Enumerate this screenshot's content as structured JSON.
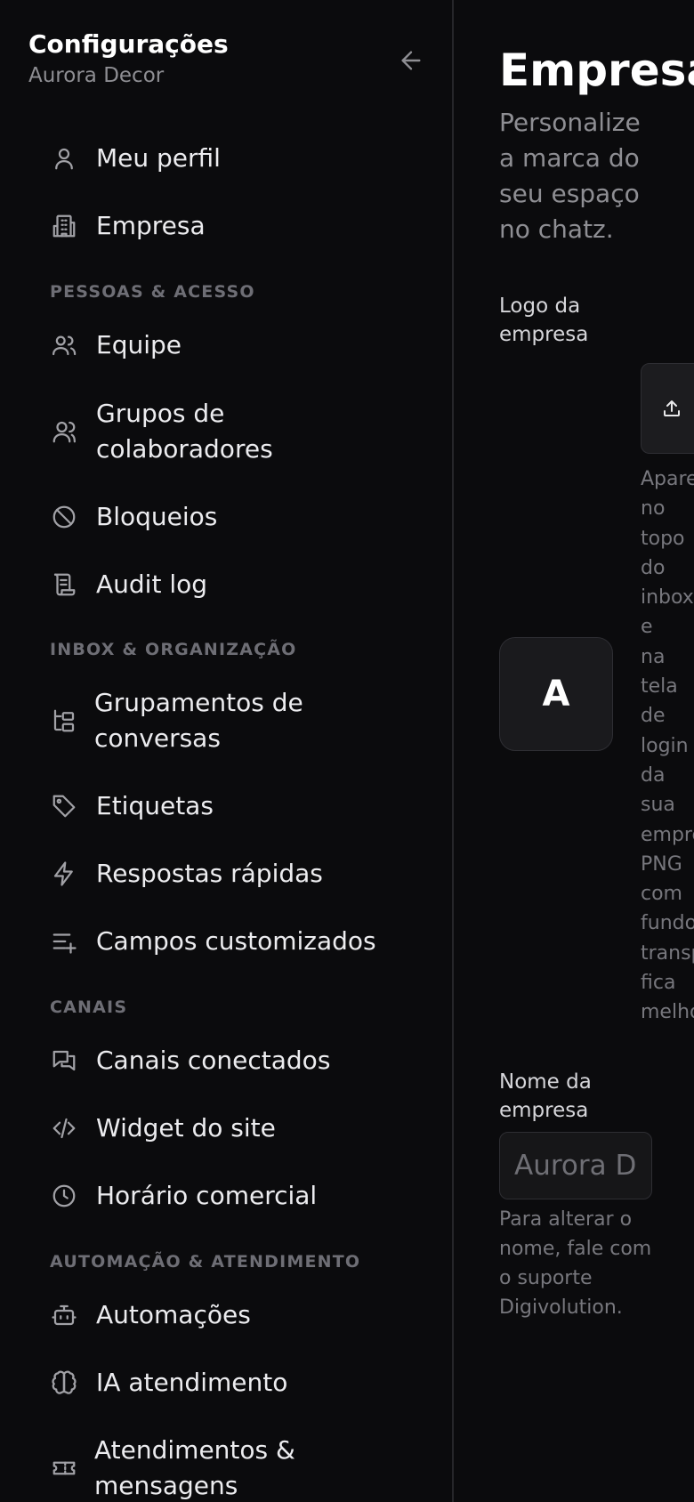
{
  "sidebar": {
    "title": "Configurações",
    "subtitle": "Aurora Decor",
    "back_icon": "arrow-left-icon",
    "items": [
      {
        "label": "Meu perfil",
        "icon": "user-icon"
      },
      {
        "label": "Empresa",
        "icon": "building-icon"
      },
      {
        "label": "Equipe",
        "icon": "users-icon"
      },
      {
        "label": "Grupos de colaboradores",
        "icon": "user-group-icon"
      },
      {
        "label": "Bloqueios",
        "icon": "ban-icon"
      },
      {
        "label": "Audit log",
        "icon": "scroll-icon"
      },
      {
        "label": "Grupamentos de conversas",
        "icon": "folder-tree-icon"
      },
      {
        "label": "Etiquetas",
        "icon": "tag-icon"
      },
      {
        "label": "Respostas rápidas",
        "icon": "zap-icon"
      },
      {
        "label": "Campos customizados",
        "icon": "list-plus-icon"
      },
      {
        "label": "Canais conectados",
        "icon": "messages-icon"
      },
      {
        "label": "Widget do site",
        "icon": "code-icon"
      },
      {
        "label": "Horário comercial",
        "icon": "clock-icon"
      },
      {
        "label": "Automações",
        "icon": "bot-icon"
      },
      {
        "label": "IA atendimento",
        "icon": "brain-icon"
      },
      {
        "label": "Atendimentos & mensagens",
        "icon": "ticket-icon"
      }
    ],
    "sections": [
      "PESSOAS & ACESSO",
      "INBOX & ORGANIZAÇÃO",
      "CANAIS",
      "AUTOMAÇÃO & ATENDIMENTO"
    ]
  },
  "main": {
    "title": "Empresa",
    "description": "Personalize a marca do seu espaço no chatz.",
    "logo": {
      "label": "Logo da empresa",
      "placeholder_letter": "A",
      "upload_icon": "upload-icon",
      "hint": "Aparece no topo do inbox e na tela de login da sua empresa. PNG com fundo transparente fica melhor."
    },
    "company_name": {
      "label": "Nome da empresa",
      "value": "Aurora Decor",
      "hint": "Para alterar o nome, fale com o suporte Digivolution."
    }
  },
  "colors": {
    "background": "#0b0b0d",
    "text": "#e8e8ea",
    "muted": "#8e8e93",
    "section": "#6e6e75",
    "border": "#26262a"
  }
}
